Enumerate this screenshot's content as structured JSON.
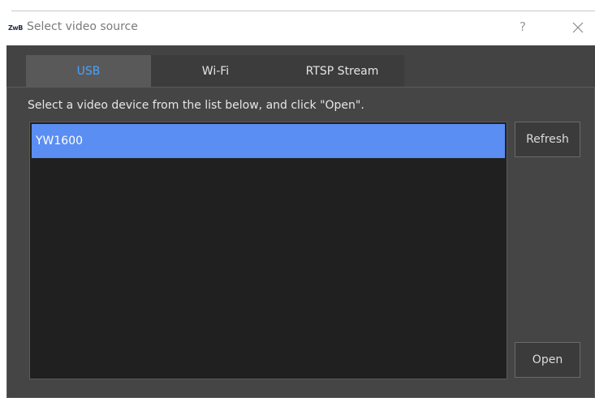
{
  "window": {
    "app_icon_text": "ZwB",
    "title": "Select video source",
    "help_label": "?",
    "close_icon": "close-icon"
  },
  "tabs": [
    {
      "label": "USB",
      "active": true
    },
    {
      "label": "Wi-Fi",
      "active": false
    },
    {
      "label": "RTSP Stream",
      "active": false
    }
  ],
  "panel": {
    "instruction": "Select a video device from the list below, and click \"Open\".",
    "devices": [
      {
        "name": "YW1600",
        "selected": true
      }
    ],
    "refresh_label": "Refresh",
    "open_label": "Open"
  },
  "colors": {
    "accent_tab": "#4aa3ff",
    "selection": "#5b8ef2",
    "dialog_bg": "#434343",
    "list_bg": "#202020"
  }
}
